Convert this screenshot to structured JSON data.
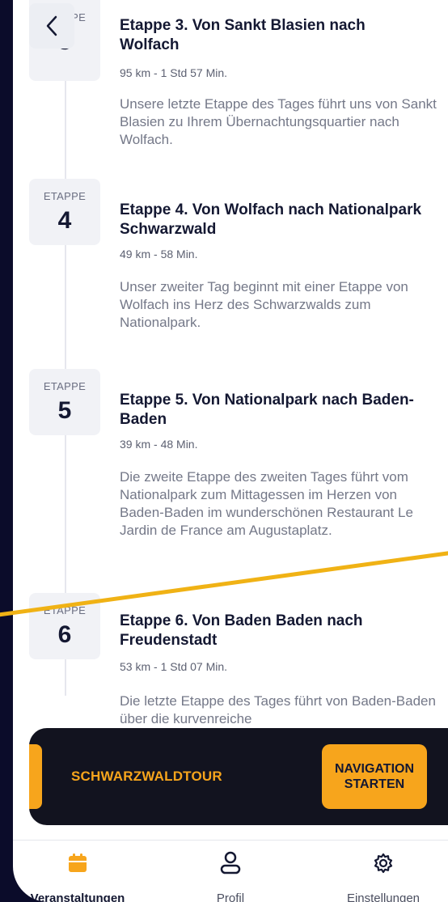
{
  "header": {
    "back_icon": "chevron-left-icon"
  },
  "stages": [
    {
      "label": "ETAPPE",
      "number": "3",
      "title": "Etappe 3. Von Sankt Blasien nach Wolfach",
      "meta": "95 km - 1 Std 57 Min.",
      "description": "Unsere letzte Etappe des Tages führt uns von Sankt Blasien zu Ihrem Übernachtungsquartier nach Wolfach."
    },
    {
      "label": "ETAPPE",
      "number": "4",
      "title": "Etappe 4. Von Wolfach nach Nationalpark Schwarzwald",
      "meta": "49 km - 58 Min.",
      "description": "Unser zweiter Tag beginnt mit einer Etappe von Wolfach ins Herz des Schwarzwalds zum Nationalpark."
    },
    {
      "label": "ETAPPE",
      "number": "5",
      "title": "Etappe 5. Von Nationalpark nach Baden-Baden",
      "meta": "39 km - 48 Min.",
      "description": "Die zweite Etappe des zweiten Tages führt vom Nationalpark zum Mittagessen im Herzen von Baden-Baden im wunderschönen Restaurant Le Jardin de France am Augustaplatz."
    },
    {
      "label": "ETAPPE",
      "number": "6",
      "title": "Etappe 6. Von Baden Baden nach Freudenstadt",
      "meta": "53 km - 1 Std 07 Min.",
      "description": "Die letzte Etappe des Tages führt von Baden-Baden über die kurvenreiche"
    }
  ],
  "tour_bar": {
    "name": "SCHWARZWALDTOUR",
    "nav_button": "NAVIGATION\nSTARTEN"
  },
  "tabs": [
    {
      "label": "Veranstaltungen",
      "icon": "calendar-icon",
      "active": true
    },
    {
      "label": "Profil",
      "icon": "person-icon",
      "active": false
    },
    {
      "label": "Einstellungen",
      "icon": "gear-icon",
      "active": false
    }
  ],
  "colors": {
    "accent": "#f7a51c",
    "dark": "#141832",
    "background": "#0b0c2a"
  }
}
